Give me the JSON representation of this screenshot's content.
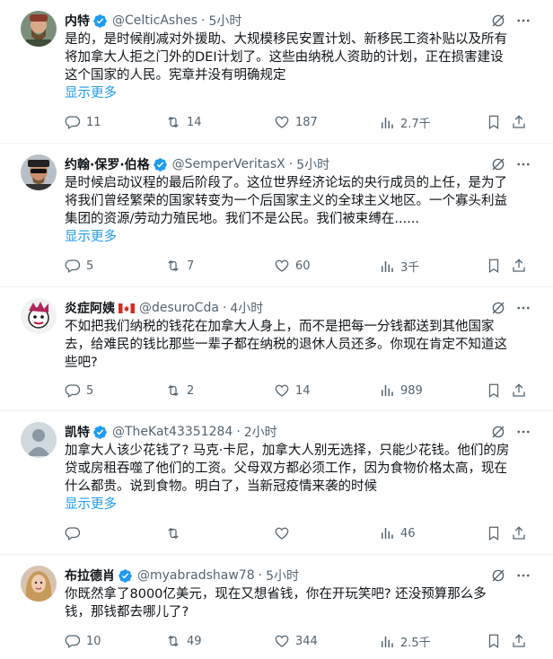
{
  "tweets": [
    {
      "name": "内特",
      "handle": "@CelticAshes",
      "time": "5小时",
      "verified": true,
      "lines": [
        "是的，是时候削减对外援助、大规模移民安置计划、新移民工资补贴以及所有",
        "将加拿大人拒之门外的DEI计划了。这些由纳税人资助的计划，正在损害建设",
        "这个国家的人民。宪章并没有明确规定"
      ],
      "show_more": "显示更多",
      "replies": "11",
      "retweets": "14",
      "likes": "187",
      "views": "2.7千"
    },
    {
      "name": "约翰·保罗·伯格",
      "handle": "@SemperVeritasX",
      "time": "5小时",
      "verified": true,
      "lines": [
        "是时候启动议程的最后阶段了。这位世界经济论坛的央行成员的上任，是为了",
        "将我们曾经繁荣的国家转变为一个后国家主义的全球主义地区。一个寡头利益",
        "集团的资源/劳动力殖民地。我们不是公民。我们被束缚在......"
      ],
      "show_more": "显示更多",
      "replies": "5",
      "retweets": "7",
      "likes": "60",
      "views": "3千"
    },
    {
      "name": "炎症阿姨",
      "handle": "@desuroCda",
      "time": "4小时",
      "verified": false,
      "lines": [
        "不如把我们纳税的钱花在加拿大人身上，而不是把每一分钱都送到其他国家",
        "去，给难民的钱比那些一辈子都在纳税的退休人员还多。你现在肯定不知道这",
        "些吧?"
      ],
      "show_more": "",
      "replies": "5",
      "retweets": "2",
      "likes": "14",
      "views": "989"
    },
    {
      "name": "凯特",
      "handle": "@TheKat43351284",
      "time": "2小时",
      "verified": true,
      "lines": [
        "加拿大人该少花钱了? 马克·卡尼，加拿大人别无选择，只能少花钱。他们的房",
        "贷或房租吞噬了他们的工资。父母双方都必须工作，因为食物价格太高，现在",
        "什么都贵。说到食物。明白了，当新冠疫情来袭的时候"
      ],
      "show_more": "显示更多",
      "replies": "",
      "retweets": "",
      "likes": "",
      "views": "46"
    },
    {
      "name": "布拉德肖",
      "handle": "@myabradshaw78",
      "time": "5小时",
      "verified": true,
      "lines": [
        "你既然拿了8000亿美元，现在又想省钱，你在开玩笑吧? 还没预算那么多",
        "钱，那钱都去哪儿了?"
      ],
      "show_more": "",
      "replies": "10",
      "retweets": "49",
      "likes": "344",
      "views": "2.5千"
    }
  ],
  "colors": {
    "accent": "#1d9bf0",
    "muted": "#536471",
    "text": "#0f1419",
    "divider": "#eff3f4"
  }
}
